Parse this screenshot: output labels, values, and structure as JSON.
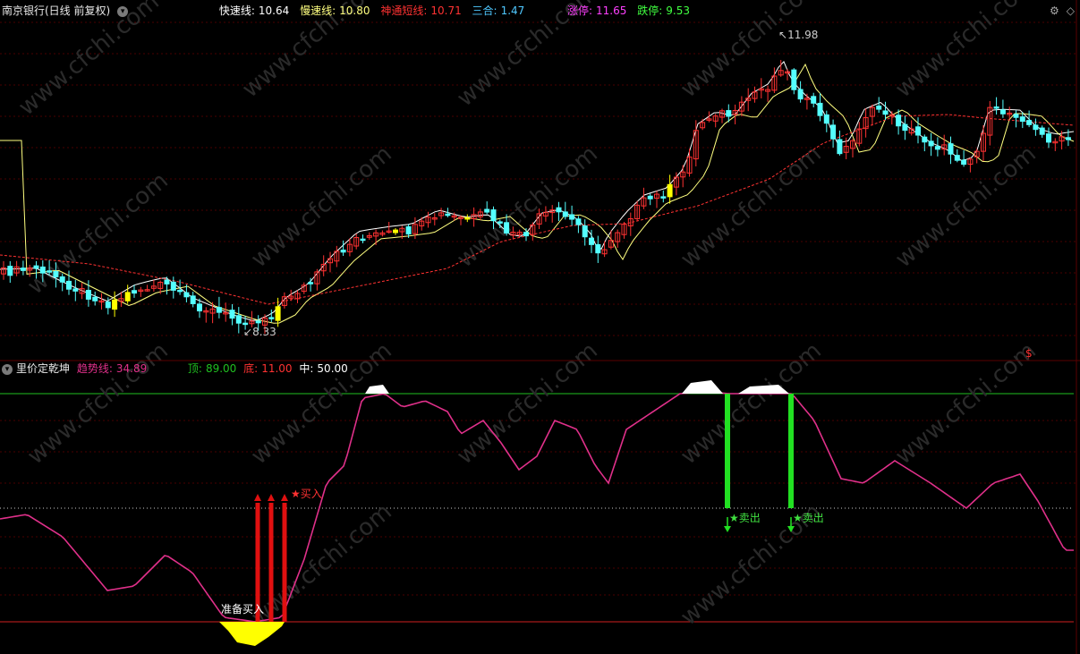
{
  "colors": {
    "bg": "#000000",
    "up": "#ff3232",
    "down": "#54ffff",
    "limit_up_bar": "#ffff00",
    "fast_line": "#ffffff",
    "slow_line": "#ffff80",
    "short_line": "#ff3232",
    "trend_line": "#e0308a",
    "top_line": "#20c020",
    "bottom_line": "#d02020",
    "mid_line": "#cccccc"
  },
  "main_panel": {
    "stock_title": "南京银行(日线 前复权)",
    "indicators": [
      {
        "label": "快速线:",
        "value": "10.64",
        "color": "#ffffff"
      },
      {
        "label": "慢速线:",
        "value": "10.80",
        "color": "#ffff80"
      },
      {
        "label": "神通短线:",
        "value": "10.71",
        "color": "#ff3232"
      },
      {
        "label": "三合:",
        "value": "1.47",
        "color": "#4fc8ff"
      },
      {
        "label": "涨停:",
        "value": "11.65",
        "color": "#ff40ff"
      },
      {
        "label": "跌停:",
        "value": "9.53",
        "color": "#40ff40"
      }
    ],
    "high_marker": "11.98",
    "low_marker": "8.33",
    "dollar_marker": "$",
    "window_icons": [
      "settings-icon",
      "diamond-icon"
    ]
  },
  "indicator_panel": {
    "name": "里价定乾坤",
    "trend_label": "趋势线:",
    "trend_value": "34.89",
    "top_label": "顶:",
    "top_value": "89.00",
    "bottom_label": "底:",
    "bottom_value": "11.00",
    "mid_label": "中:",
    "mid_value": "50.00",
    "signal_buy": "★买入",
    "signal_prepare": "准备买入",
    "signal_sell_1": "★卖出",
    "signal_sell_2": "★卖出"
  },
  "watermark": "www.cfchi.com"
}
